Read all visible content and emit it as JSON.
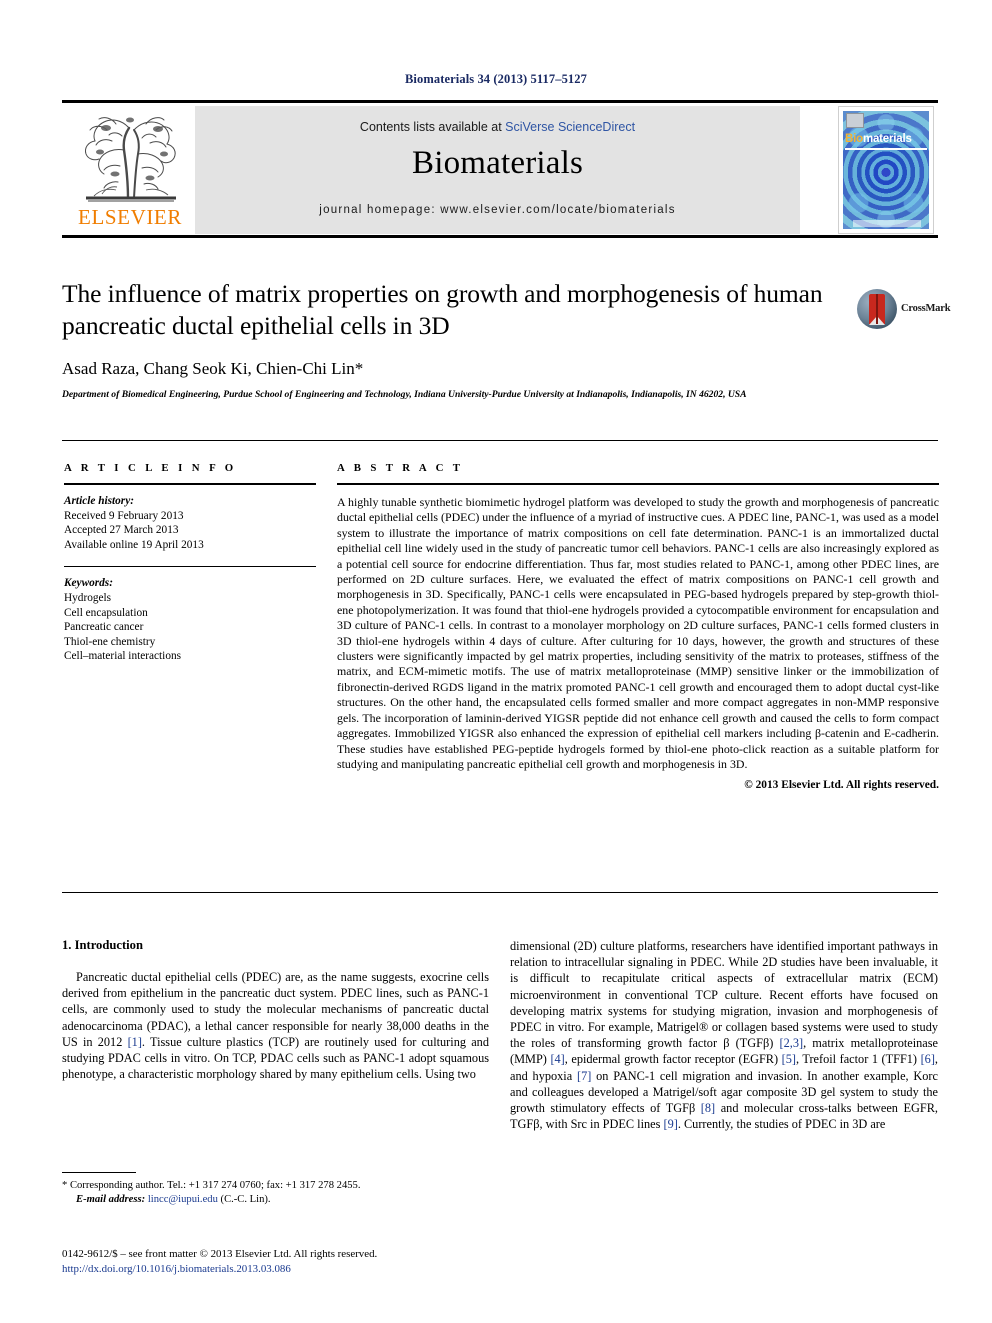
{
  "running_head": "Biomaterials 34 (2013) 5117–5127",
  "masthead": {
    "publisher_name": "ELSEVIER",
    "contents_prefix": "Contents lists available at ",
    "contents_link": "SciVerse ScienceDirect",
    "journal_title": "Biomaterials",
    "homepage": "journal homepage: www.elsevier.com/locate/biomaterials",
    "cover": {
      "title_part1": "Bio",
      "title_part2": "materials"
    }
  },
  "article": {
    "title": "The influence of matrix properties on growth and morphogenesis of human pancreatic ductal epithelial cells in 3D",
    "authors": "Asad Raza, Chang Seok Ki, Chien-Chi Lin*",
    "affiliation": "Department of Biomedical Engineering, Purdue School of Engineering and Technology, Indiana University-Purdue University at Indianapolis, Indianapolis, IN 46202, USA",
    "crossmark_label": "CrossMark"
  },
  "article_info": {
    "heading": "A R T I C L E  I N F O",
    "history_label": "Article history:",
    "history": [
      "Received 9 February 2013",
      "Accepted 27 March 2013",
      "Available online 19 April 2013"
    ],
    "keywords_label": "Keywords:",
    "keywords": [
      "Hydrogels",
      "Cell encapsulation",
      "Pancreatic cancer",
      "Thiol-ene chemistry",
      "Cell–material interactions"
    ]
  },
  "abstract": {
    "heading": "A B S T R A C T",
    "text": "A highly tunable synthetic biomimetic hydrogel platform was developed to study the growth and morphogenesis of pancreatic ductal epithelial cells (PDEC) under the influence of a myriad of instructive cues. A PDEC line, PANC-1, was used as a model system to illustrate the importance of matrix compositions on cell fate determination. PANC-1 is an immortalized ductal epithelial cell line widely used in the study of pancreatic tumor cell behaviors. PANC-1 cells are also increasingly explored as a potential cell source for endocrine differentiation. Thus far, most studies related to PANC-1, among other PDEC lines, are performed on 2D culture surfaces. Here, we evaluated the effect of matrix compositions on PANC-1 cell growth and morphogenesis in 3D. Specifically, PANC-1 cells were encapsulated in PEG-based hydrogels prepared by step-growth thiol-ene photopolymerization. It was found that thiol-ene hydrogels provided a cytocompatible environment for encapsulation and 3D culture of PANC-1 cells. In contrast to a monolayer morphology on 2D culture surfaces, PANC-1 cells formed clusters in 3D thiol-ene hydrogels within 4 days of culture. After culturing for 10 days, however, the growth and structures of these clusters were significantly impacted by gel matrix properties, including sensitivity of the matrix to proteases, stiffness of the matrix, and ECM-mimetic motifs. The use of matrix metalloproteinase (MMP) sensitive linker or the immobilization of fibronectin-derived RGDS ligand in the matrix promoted PANC-1 cell growth and encouraged them to adopt ductal cyst-like structures. On the other hand, the encapsulated cells formed smaller and more compact aggregates in non-MMP responsive gels. The incorporation of laminin-derived YIGSR peptide did not enhance cell growth and caused the cells to form compact aggregates. Immobilized YIGSR also enhanced the expression of epithelial cell markers including β-catenin and E-cadherin. These studies have established PEG-peptide hydrogels formed by thiol-ene photo-click reaction as a suitable platform for studying and manipulating pancreatic epithelial cell growth and morphogenesis in 3D.",
    "copyright": "© 2013 Elsevier Ltd. All rights reserved."
  },
  "body": {
    "section_heading": "1. Introduction",
    "left_para_1": "Pancreatic ductal epithelial cells (PDEC) are, as the name suggests, exocrine cells derived from epithelium in the pancreatic duct system. PDEC lines, such as PANC-1 cells, are commonly used to study the molecular mechanisms of pancreatic ductal adenocarcinoma (PDAC), a lethal cancer responsible for nearly 38,000 deaths in the US in 2012 ",
    "left_ref_1": "[1]",
    "left_para_1b": ". Tissue culture plastics (TCP) are routinely used for culturing and studying PDAC cells in vitro. On TCP, PDAC cells such as PANC-1 adopt squamous phenotype, a characteristic morphology shared by many epithelium cells. Using two",
    "right_para_1": "dimensional (2D) culture platforms, researchers have identified important pathways in relation to intracellular signaling in PDEC. While 2D studies have been invaluable, it is difficult to recapitulate critical aspects of extracellular matrix (ECM) microenvironment in conventional TCP culture. Recent efforts have focused on developing matrix systems for studying migration, invasion and morphogenesis of PDEC in vitro. For example, Matrigel® or collagen based systems were used to study the roles of transforming growth factor β (TGFβ) ",
    "right_ref_1": "[2,3]",
    "right_para_2": ", matrix metalloproteinase (MMP) ",
    "right_ref_2": "[4]",
    "right_para_3": ", epidermal growth factor receptor (EGFR) ",
    "right_ref_3": "[5]",
    "right_para_4": ", Trefoil factor 1 (TFF1) ",
    "right_ref_4": "[6]",
    "right_para_5": ", and hypoxia ",
    "right_ref_5": "[7]",
    "right_para_6": " on PANC-1 cell migration and invasion. In another example, Korc and colleagues developed a Matrigel/soft agar composite 3D gel system to study the growth stimulatory effects of TGFβ ",
    "right_ref_6": "[8]",
    "right_para_7": " and molecular cross-talks between EGFR, TGFβ, with Src in PDEC lines ",
    "right_ref_7": "[9]",
    "right_para_8": ". Currently, the studies of PDEC in 3D are"
  },
  "footnote": {
    "corresponding": "* Corresponding author. Tel.: +1 317 274 0760; fax: +1 317 278 2455.",
    "email_label": "E-mail address:",
    "email": "lincc@iupui.edu",
    "email_suffix": " (C.-C. Lin)."
  },
  "colophon": {
    "issn_line": "0142-9612/$ – see front matter © 2013 Elsevier Ltd. All rights reserved.",
    "doi": "http://dx.doi.org/10.1016/j.biomaterials.2013.03.086"
  }
}
